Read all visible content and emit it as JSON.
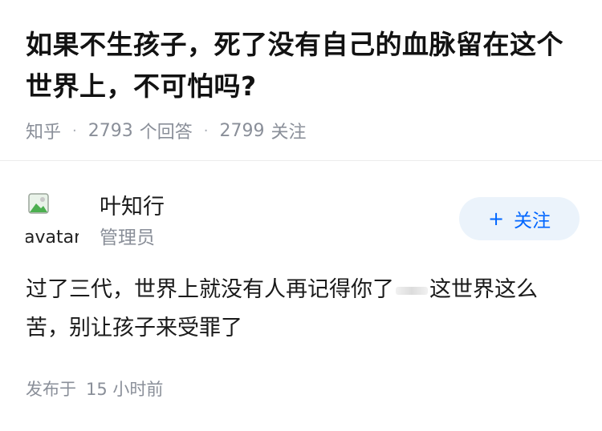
{
  "question": {
    "title": "如果不生孩子，死了没有自己的血脉留在这个世界上，不可怕吗?",
    "source": "知乎",
    "separator": "·",
    "answer_count": "2793",
    "answer_count_label": "个回答",
    "follower_count": "2799",
    "follower_count_label": "关注"
  },
  "author": {
    "name": "叶知行",
    "role": "管理员",
    "avatar_alt": "avatar",
    "follow_icon": "plus-icon",
    "follow_plus": "+",
    "follow_label": "关注"
  },
  "answer": {
    "text_before": "过了三代，世界上就没有人再记得你了",
    "text_after": "这世界这么苦，别让孩子来受罪了"
  },
  "footer": {
    "published_label": "发布于",
    "published_time": "15 小时前"
  },
  "colors": {
    "accent": "#0066ff",
    "follow_bg": "#ebf3fb",
    "meta_gray": "#8a8f99",
    "title": "#121212"
  }
}
